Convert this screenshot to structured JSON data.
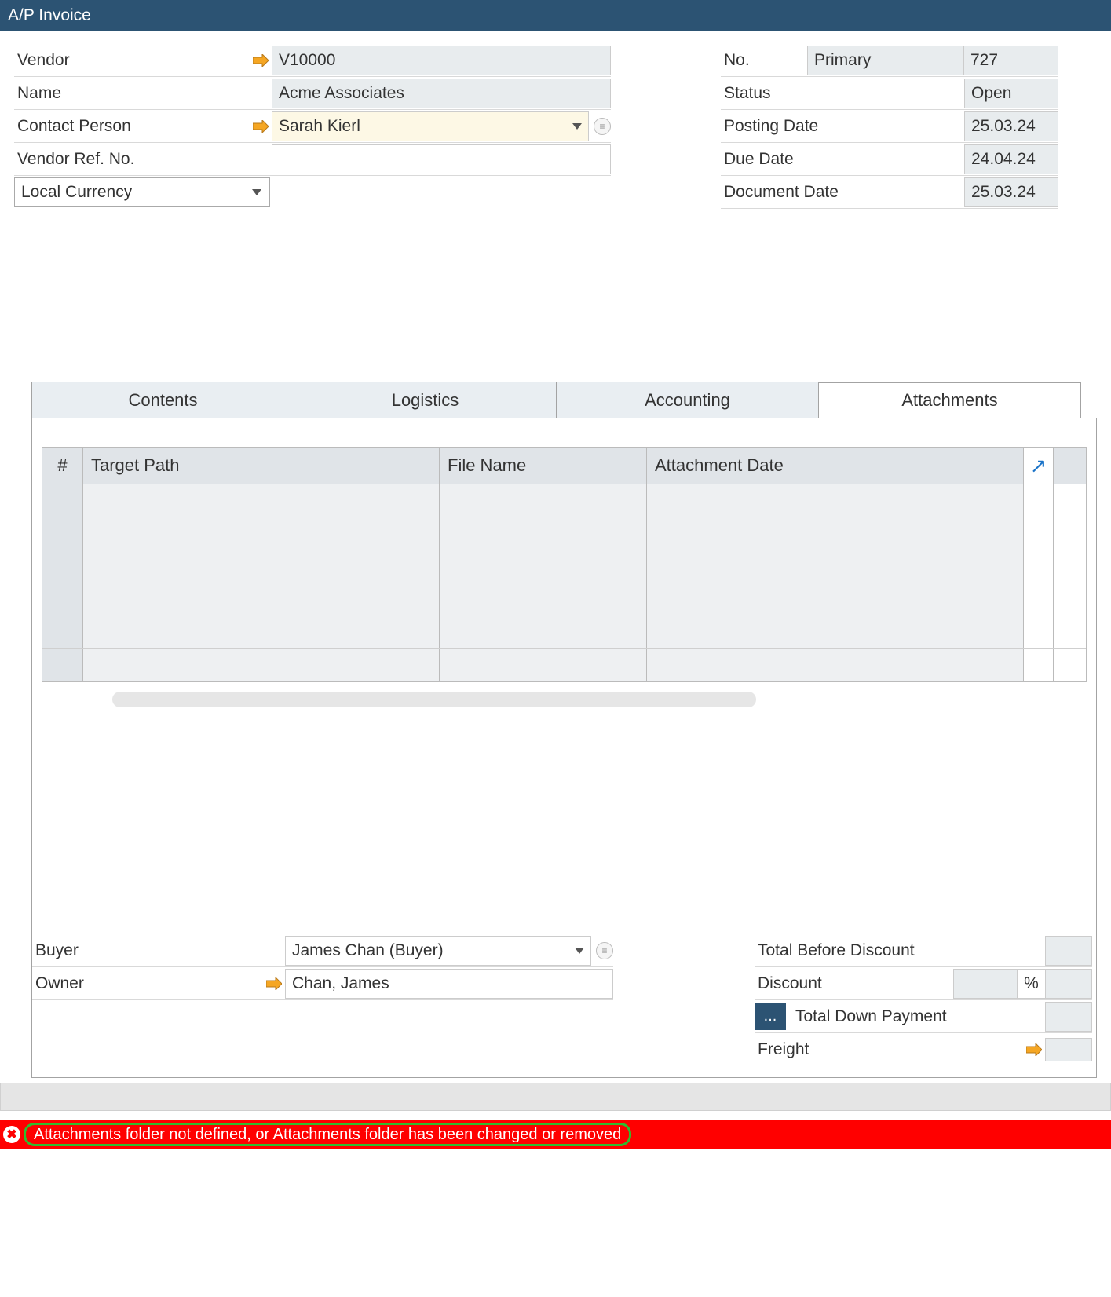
{
  "window": {
    "title": "A/P Invoice"
  },
  "header": {
    "left": {
      "vendor_label": "Vendor",
      "vendor_value": "V10000",
      "name_label": "Name",
      "name_value": "Acme Associates",
      "contact_label": "Contact Person",
      "contact_value": "Sarah Kierl",
      "vendorref_label": "Vendor Ref. No.",
      "vendorref_value": "",
      "currency_value": "Local Currency"
    },
    "right": {
      "no_label": "No.",
      "no_series": "Primary",
      "no_value": "727",
      "status_label": "Status",
      "status_value": "Open",
      "posting_label": "Posting Date",
      "posting_value": "25.03.24",
      "due_label": "Due Date",
      "due_value": "24.04.24",
      "doc_label": "Document Date",
      "doc_value": "25.03.24"
    }
  },
  "tabs": {
    "contents": "Contents",
    "logistics": "Logistics",
    "accounting": "Accounting",
    "attachments": "Attachments"
  },
  "attachments_table": {
    "col_num": "#",
    "col_path": "Target Path",
    "col_file": "File Name",
    "col_date": "Attachment Date",
    "rows": [
      {},
      {},
      {},
      {},
      {},
      {}
    ]
  },
  "footer": {
    "buyer_label": "Buyer",
    "buyer_value": "James Chan (Buyer)",
    "owner_label": "Owner",
    "owner_value": "Chan, James",
    "total_before_label": "Total Before Discount",
    "discount_label": "Discount",
    "discount_pct_symbol": "%",
    "downpayment_label": "Total Down Payment",
    "freight_label": "Freight"
  },
  "status": {
    "error": "Attachments folder not defined, or Attachments folder has been changed or removed"
  }
}
